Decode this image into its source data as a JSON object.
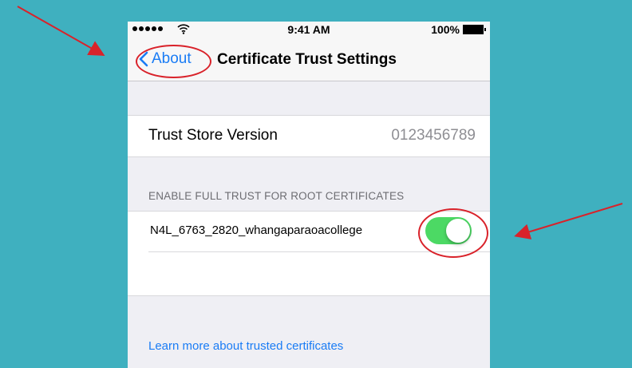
{
  "statusbar": {
    "time": "9:41 AM",
    "battery": "100%"
  },
  "navbar": {
    "back_label": "About",
    "title": "Certificate Trust Settings"
  },
  "trust_store": {
    "label": "Trust Store Version",
    "value": "0123456789"
  },
  "full_trust": {
    "section_header": "ENABLE FULL TRUST FOR ROOT CERTIFICATES",
    "certificates": [
      {
        "name": "N4L_6763_2820_whangaparaoacollege",
        "enabled": true
      }
    ]
  },
  "learn_more_link": "Learn more about trusted certificates",
  "colors": {
    "background": "#3fb0bf",
    "accent_blue": "#1a7cf5",
    "toggle_on": "#4cd964",
    "annotation_red": "#d9222a"
  }
}
